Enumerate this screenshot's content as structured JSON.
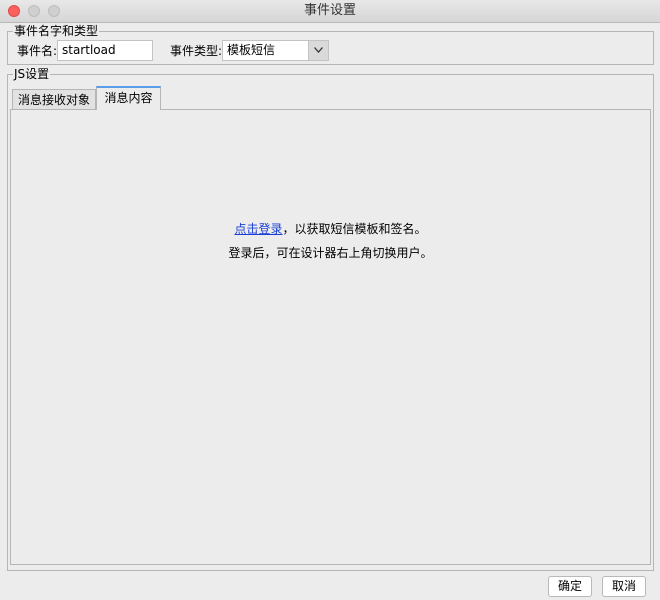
{
  "window": {
    "title": "事件设置"
  },
  "event_group": {
    "legend": "事件名字和类型",
    "name_label": "事件名:",
    "name_value": "startload",
    "type_label": "事件类型:",
    "type_value": "模板短信"
  },
  "js_group": {
    "legend": "JS设置",
    "tabs": [
      {
        "label": "消息接收对象",
        "active": false
      },
      {
        "label": "消息内容",
        "active": true
      }
    ],
    "content": {
      "link_text": "点击登录",
      "line1_rest": "，以获取短信模板和签名。",
      "line2": "登录后，可在设计器右上角切换用户。"
    }
  },
  "footer": {
    "ok_label": "确定",
    "cancel_label": "取消"
  }
}
